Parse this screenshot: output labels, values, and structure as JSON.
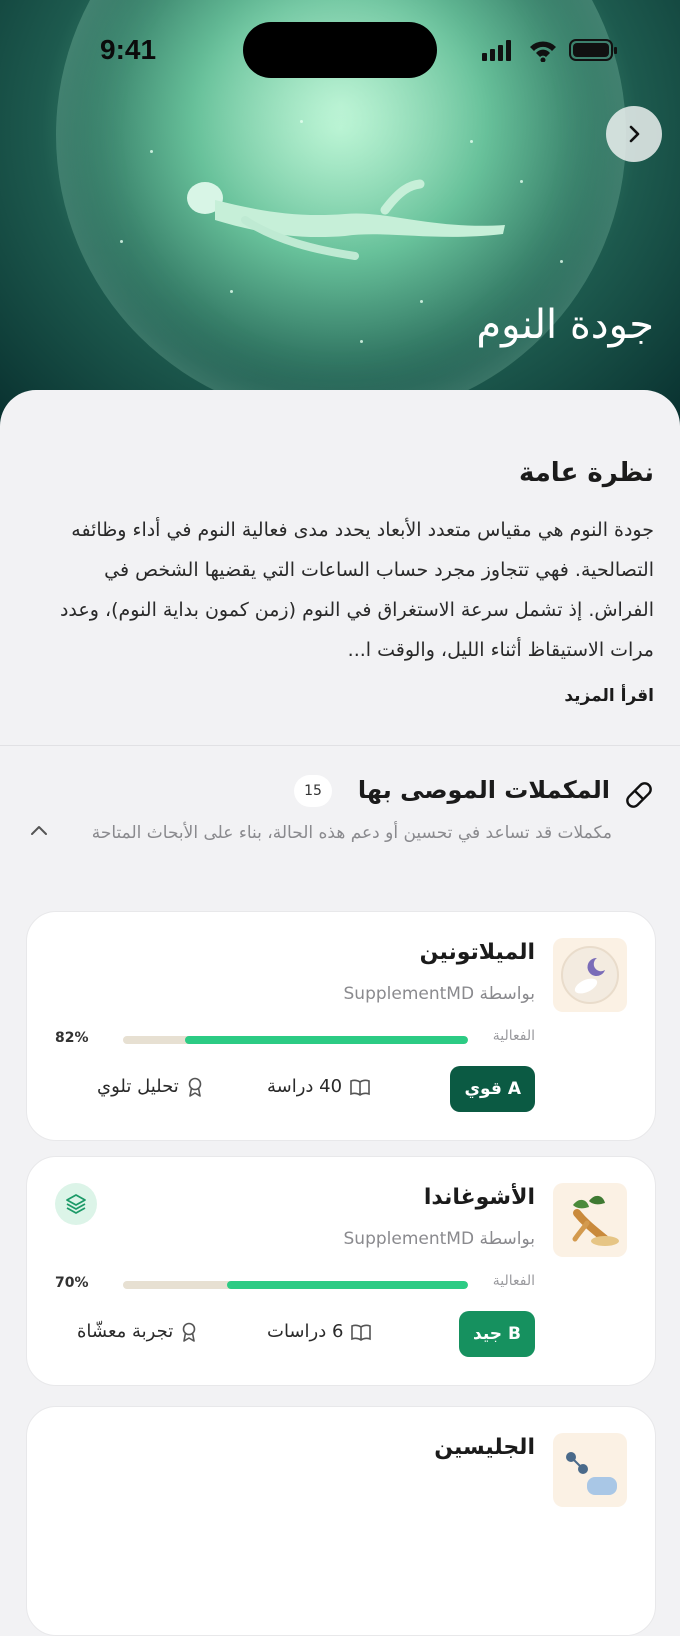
{
  "status": {
    "time": "9:41"
  },
  "hero": {
    "title": "جودة النوم"
  },
  "overview": {
    "title": "نظرة عامة",
    "text": "جودة النوم هي مقياس متعدد الأبعاد يحدد مدى فعالية النوم في أداء وظائفه التصالحية. فهي تتجاوز مجرد حساب الساعات التي يقضيها الشخص في الفراش. إذ تشمل سرعة الاستغراق في النوم (زمن كمون بداية النوم)، وعدد مرات الاستيقاظ أثناء الليل، والوقت ا...",
    "read_more": "اقرأ المزيد"
  },
  "recommended": {
    "title": "المكملات الموصى بها",
    "count": "15",
    "subtitle": "مكملات قد تساعد في تحسين أو دعم هذه الحالة، بناء على الأبحاث المتاحة"
  },
  "effectiveness_label": "الفعالية",
  "supplements": [
    {
      "name": "الميلاتونين",
      "by": "بواسطة SupplementMD",
      "effectiveness": 0.82,
      "effectiveness_text": "82%",
      "grade_letter": "A",
      "grade_label": "قوي",
      "grade_color": "#0b5a43",
      "studies": "40 دراسة",
      "evidence": "تحليل تلوي"
    },
    {
      "name": "الأشوغاندا",
      "by": "بواسطة SupplementMD",
      "effectiveness": 0.7,
      "effectiveness_text": "70%",
      "grade_letter": "B",
      "grade_label": "جيد",
      "grade_color": "#16915f",
      "studies": "6 دراسات",
      "evidence": "تجربة معشّاة"
    },
    {
      "name": "الجليسين"
    }
  ],
  "colors": {
    "accent": "#2ccb84",
    "track": "#e7e0d2"
  }
}
